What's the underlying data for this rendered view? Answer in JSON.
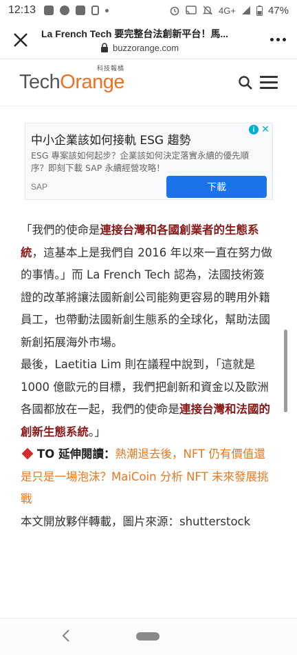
{
  "status_bar": {
    "time": "12:13",
    "network": "4G+",
    "battery": "47%"
  },
  "browser": {
    "page_title": "La French Tech 要完整台法創新平台！馬...",
    "url": "buzzorange.com"
  },
  "site": {
    "logo_tech": "Tech",
    "logo_orange": "Orange",
    "logo_zh": "科技報橘"
  },
  "ad": {
    "title": "中小企業該如何接軌 ESG 趨勢",
    "description": "ESG 專案該如何起步？企業該如何決定落實永續的優先順序？即刻下載 SAP 永續經營攻略！",
    "source": "SAP",
    "button": "下載"
  },
  "article": {
    "p1_a": "「我們的使命是",
    "p1_hl": "連接台灣和各國創業者的生態系統",
    "p1_b": "，這基本上是我們自 2016 年以來一直在努力做的事情。」而 La French Tech 認為，法國技術簽證的改革將讓法國新創公司能夠更容易的聘用外籍員工，也帶動法國新創生態系的全球化，幫助法國新創拓展海外市場。",
    "p2_a": "最後，Laetitia Lim 則在議程中說到，「這就是 1000 億歐元的目標，我們把創新和資金以及歐洲各國都放在一起，我們的使命是",
    "p2_hl": "連接台灣和法國的創新生態系統",
    "p2_b": "。」",
    "p3_label": "TO 延伸閱讀：",
    "p3_link": "熱潮退去後，NFT 仍有價值還是只是一場泡沫？MaiCoin 分析 NFT 未來發展挑戰",
    "p4": "本文開放夥伴轉載，圖片來源：shutterstock"
  }
}
